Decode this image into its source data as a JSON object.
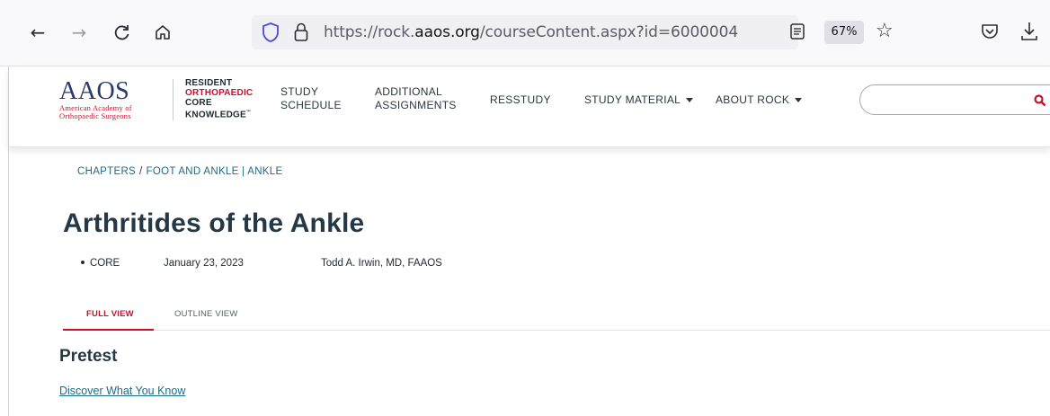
{
  "browser": {
    "url_prefix": "https://rock.",
    "url_domain": "aaos.org",
    "url_suffix": "/courseContent.aspx?id=6000004",
    "zoom": "67%",
    "icons": [
      "back-icon",
      "forward-icon",
      "reload-icon",
      "home-icon",
      "shield-icon",
      "lock-icon",
      "reader-view-icon",
      "bookmark-star-icon",
      "pocket-icon",
      "download-icon"
    ]
  },
  "header": {
    "aaos_logo": {
      "mark": "AAOS",
      "line1": "American Academy of",
      "line2": "Orthopaedic Surgeons"
    },
    "rock_logo": {
      "line1": "RESIDENT",
      "line2": "ORTHOPAEDIC",
      "line3": "CORE",
      "line4": "KNOWLEDGE"
    },
    "nav": {
      "study_schedule_line1": "STUDY",
      "study_schedule_line2": "SCHEDULE",
      "additional_line1": "ADDITIONAL",
      "additional_line2": "ASSIGNMENTS",
      "resstudy": "RESSTUDY",
      "study_material": "STUDY MATERIAL",
      "about_rock": "ABOUT ROCK"
    },
    "search": {
      "placeholder": "",
      "value": ""
    }
  },
  "content": {
    "breadcrumb": {
      "chapters": "CHAPTERS",
      "separator": "/",
      "section": "FOOT AND ANKLE | ANKLE"
    },
    "title": "Arthritides of the Ankle",
    "meta": {
      "level": "CORE",
      "date": "January 23, 2023",
      "author": "Todd A. Irwin, MD, FAAOS"
    },
    "tabs": {
      "full_view": "FULL VIEW",
      "outline_view": "OUTLINE VIEW"
    },
    "section_heading": "Pretest",
    "discover_link": "Discover What You Know"
  },
  "colors": {
    "brand_red": "#c8102e",
    "brand_navy": "#2a3b6b",
    "link_teal": "#1d6b84",
    "heading": "#253846"
  }
}
